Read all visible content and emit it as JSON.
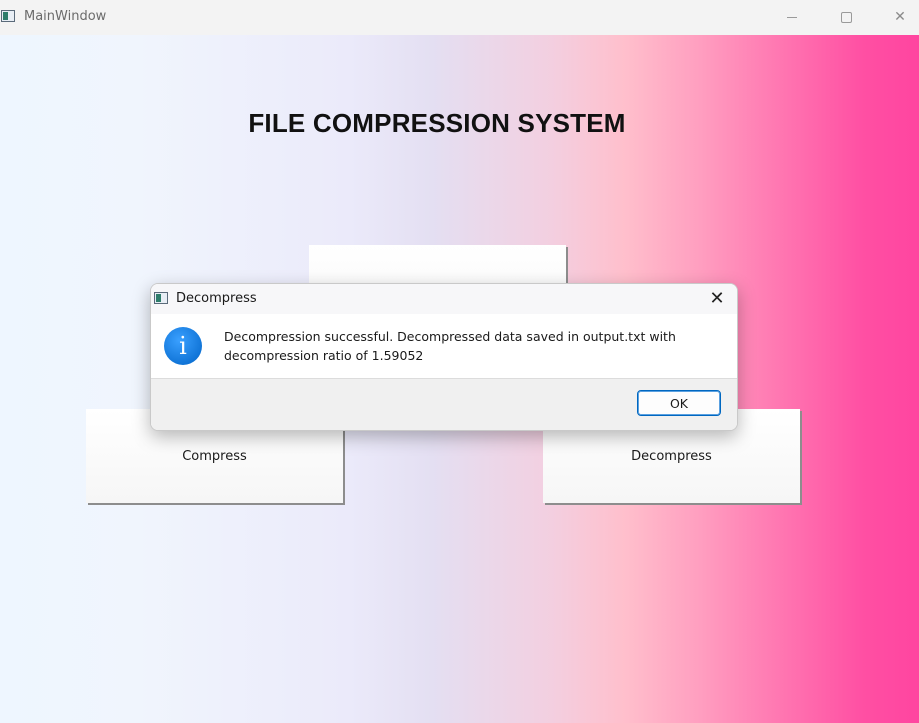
{
  "window": {
    "title": "MainWindow",
    "icon": "app-window-icon",
    "controls": {
      "minimize_icon": "minimize-icon",
      "maximize_icon": "maximize-icon",
      "close_glyph": "✕"
    }
  },
  "main": {
    "heading": "FILE COMPRESSION SYSTEM",
    "buttons": {
      "top_label": "",
      "compress_label": "Compress",
      "decompress_label": "Decompress"
    },
    "gradient_colors": [
      "#eef6ff",
      "#e4dff2",
      "#ffbfcc",
      "#ff45a0"
    ]
  },
  "dialog": {
    "title": "Decompress",
    "close_glyph": "✕",
    "icon": "info-icon",
    "icon_glyph": "i",
    "message": "Decompression successful. Decompressed data saved in output.txt with decompression ratio of 1.59052",
    "ok_label": "OK",
    "accent_color": "#0067c0"
  }
}
